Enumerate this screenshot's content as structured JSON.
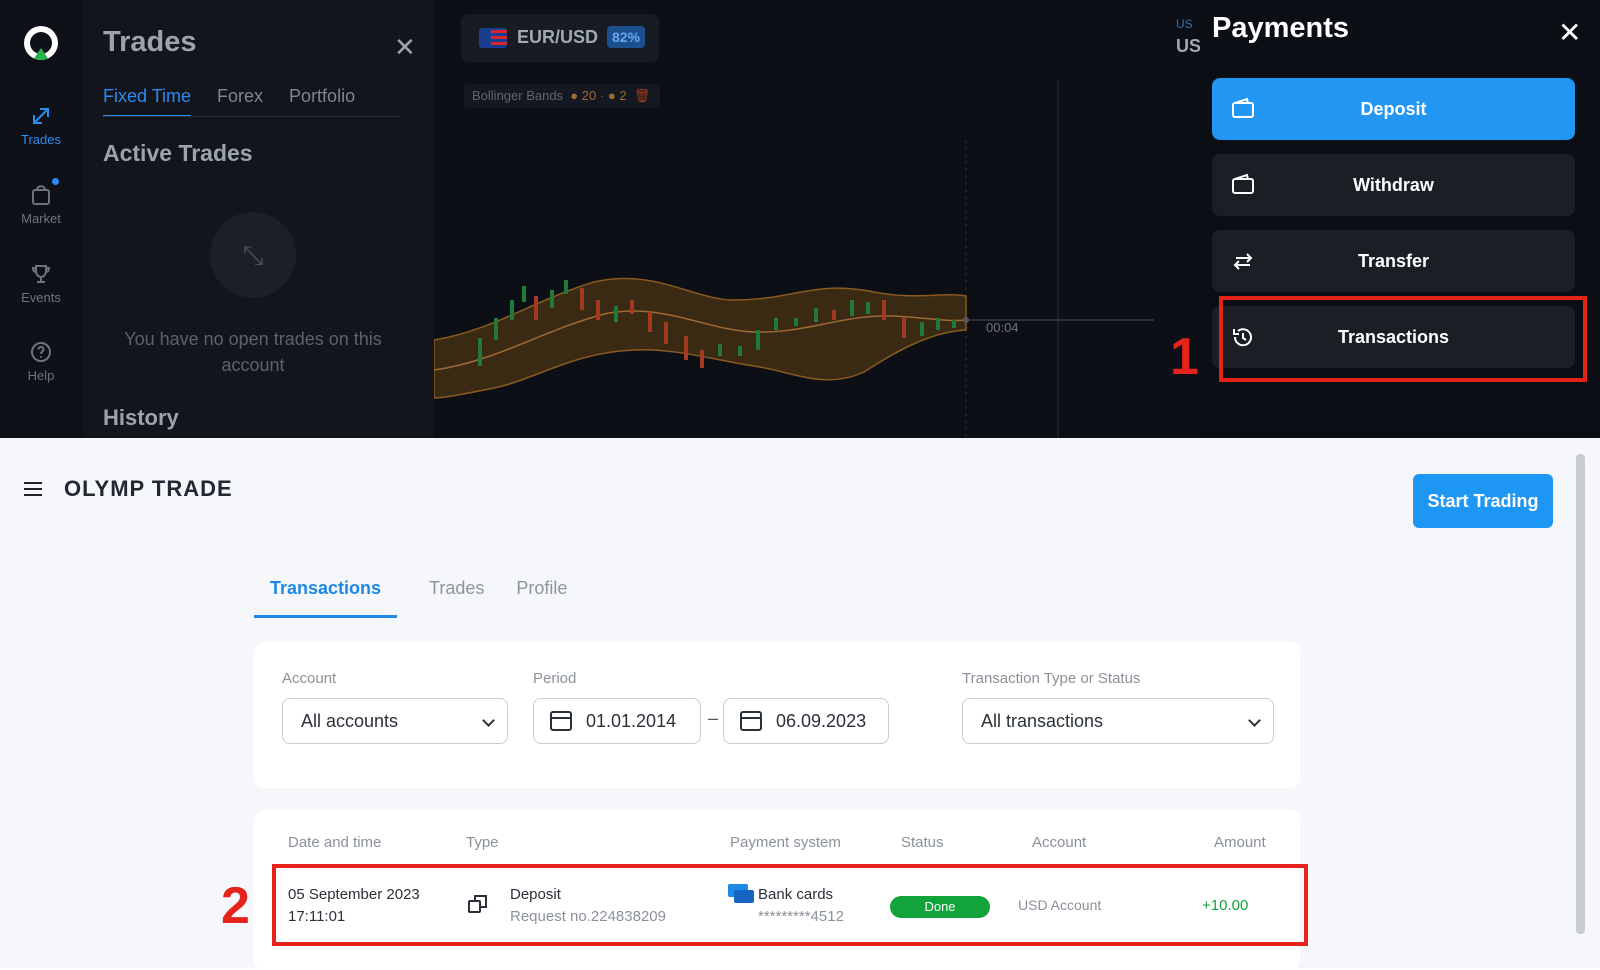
{
  "sidebar": {
    "items": [
      {
        "label": "Trades",
        "icon": "trades-icon",
        "active": true
      },
      {
        "label": "Market",
        "icon": "market-icon"
      },
      {
        "label": "Events",
        "icon": "trophy-icon"
      },
      {
        "label": "Help",
        "icon": "help-icon"
      }
    ]
  },
  "trades_panel": {
    "title": "Trades",
    "tabs": [
      "Fixed Time",
      "Forex",
      "Portfolio"
    ],
    "active_heading": "Active Trades",
    "empty_text": "You have no open trades on this account",
    "history_heading": "History"
  },
  "chart": {
    "pair": "EUR/USD",
    "payout": "82%",
    "indicator": "Bollinger Bands",
    "indicator_params": [
      "20",
      "2"
    ],
    "timer": "00:04",
    "account_short": "US",
    "account_short2": "US"
  },
  "payments": {
    "title": "Payments",
    "buttons": [
      {
        "label": "Deposit",
        "icon": "wallet-icon"
      },
      {
        "label": "Withdraw",
        "icon": "wallet-icon"
      },
      {
        "label": "Transfer",
        "icon": "transfer-icon"
      },
      {
        "label": "Transactions",
        "icon": "history-icon"
      }
    ],
    "annotation": "1",
    "accent_color": "#2196f3",
    "highlight_color": "#e5231b"
  },
  "site": {
    "brand": "OLYMP TRADE",
    "cta": "Start Trading",
    "tabs": [
      "Transactions",
      "Trades",
      "Profile"
    ]
  },
  "filters": {
    "account_label": "Account",
    "account_value": "All accounts",
    "period_label": "Period",
    "date_from": "01.01.2014",
    "date_to": "06.09.2023",
    "dash": "–",
    "type_label": "Transaction Type or Status",
    "type_value": "All transactions"
  },
  "table": {
    "headers": [
      "Date and time",
      "Type",
      "Payment system",
      "Status",
      "Account",
      "Amount"
    ],
    "rows": [
      {
        "date": "05 September 2023",
        "time": "17:11:01",
        "type": "Deposit",
        "request": "Request no.224838209",
        "payment_system": "Bank cards",
        "card": "*********4512",
        "status": "Done",
        "account": "USD Account",
        "amount": "+10.00"
      }
    ],
    "annotation": "2"
  }
}
